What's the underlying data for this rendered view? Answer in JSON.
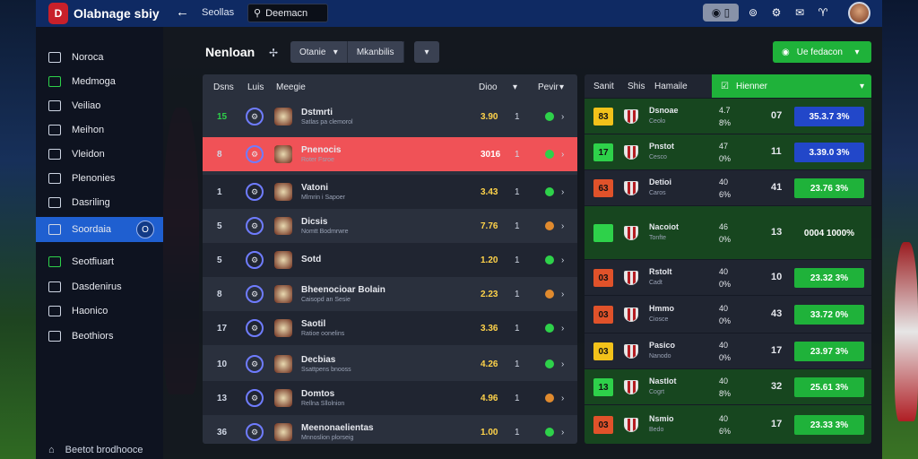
{
  "app": {
    "title": "Olabnage sbiy",
    "logo": "D"
  },
  "topbar": {
    "search_label": "Seollas",
    "search_value": "Deemacn",
    "icons": [
      "toggle-icon",
      "star-icon",
      "gear-icon",
      "bell-icon",
      "trophy-icon"
    ]
  },
  "sidebar": {
    "items": [
      {
        "label": "Noroca"
      },
      {
        "label": "Medmoga"
      },
      {
        "label": "Veiliao"
      },
      {
        "label": "Meihon"
      },
      {
        "label": "Vleidon"
      },
      {
        "label": "Plenonies"
      },
      {
        "label": "Dasriling"
      },
      {
        "label": "Soordaia",
        "badge": "O"
      },
      {
        "label": "Seotfiuart"
      },
      {
        "label": "Dasdenirus"
      },
      {
        "label": "Haonico"
      },
      {
        "label": "Beothiors"
      }
    ],
    "footer": "Beetot brodhooce"
  },
  "main": {
    "title": "Nenloan",
    "filter1": "Otanie",
    "filter2": "Mkanbilis",
    "cta": "Ue fedacon"
  },
  "left_table": {
    "headers": [
      "Dsns",
      "Luis",
      "Meegie",
      "Dioo",
      "Pevir"
    ],
    "rows": [
      {
        "num": "15",
        "name": "Dstmrti",
        "sub": "Satlas pa clemorol",
        "odds": "3.90",
        "x": "1"
      },
      {
        "num": "8",
        "name": "Pnenocis",
        "sub": "Roter Fsroe",
        "odds": "3016",
        "x": "1"
      },
      {
        "num": "1",
        "name": "Vatoni",
        "sub": "Mlmrin i Sapoer",
        "odds": "3.43",
        "x": "1"
      },
      {
        "num": "5",
        "name": "Dicsis",
        "sub": "Nomtt Bodmrwre",
        "odds": "7.76",
        "x": "1"
      },
      {
        "num": "5",
        "name": "Sotd",
        "sub": "",
        "odds": "1.20",
        "x": "1"
      },
      {
        "num": "8",
        "name": "Bheenocioar Bolain",
        "sub": "Caisopd an Sesie",
        "odds": "2.23",
        "x": "1"
      },
      {
        "num": "17",
        "name": "Saotil",
        "sub": "Ratioe oonelins",
        "odds": "3.36",
        "x": "1"
      },
      {
        "num": "10",
        "name": "Decbias",
        "sub": "Ssattpens bnooss",
        "odds": "4.26",
        "x": "1"
      },
      {
        "num": "13",
        "name": "Domtos",
        "sub": "Rellna Sllolnion",
        "odds": "4.96",
        "x": "1"
      },
      {
        "num": "36",
        "name": "Meenonaelientas",
        "sub": "Mnnoslion plorseig",
        "odds": "1.00",
        "x": "1"
      }
    ]
  },
  "right_table": {
    "headers": [
      "Sanit",
      "Shis",
      "Hamaile"
    ],
    "tab": "Hienner",
    "rows": [
      {
        "sq": "83",
        "name": "Dsnoae",
        "sub": "Ceolo",
        "a": "4.7",
        "b": "8%",
        "n": "07",
        "pct": "35.3.7  3%"
      },
      {
        "sq": "17",
        "name": "Pnstot",
        "sub": "Cesco",
        "a": "47",
        "b": "0%",
        "n": "11",
        "pct": "3.39.0  3%"
      },
      {
        "sq": "63",
        "name": "Detioi",
        "sub": "Caros",
        "a": "40",
        "b": "6%",
        "n": "41",
        "pct": "23.76  3%"
      },
      {
        "sq": "",
        "name": "Nacoiot",
        "sub": "Tonfte",
        "a": "46",
        "b": "0%",
        "n": "13",
        "pct": "0004 1000%"
      },
      {
        "sq": "03",
        "name": "Rstolt",
        "sub": "Cadt",
        "a": "40",
        "b": "0%",
        "n": "10",
        "pct": "23.32  3%"
      },
      {
        "sq": "03",
        "name": "Hmmo",
        "sub": "Ciosce",
        "a": "40",
        "b": "0%",
        "n": "43",
        "pct": "33.72  0%"
      },
      {
        "sq": "03",
        "name": "Pasico",
        "sub": "Nanodo",
        "a": "40",
        "b": "0%",
        "n": "17",
        "pct": "23.97  3%"
      },
      {
        "sq": "13",
        "name": "Nastlot",
        "sub": "Cogrt",
        "a": "40",
        "b": "8%",
        "n": "32",
        "pct": "25.61  3%"
      },
      {
        "sq": "03",
        "name": "Nsmio",
        "sub": "Bedo",
        "a": "40",
        "b": "6%",
        "n": "17",
        "pct": "23.33  3%"
      }
    ]
  },
  "colors": {
    "accent_green": "#1fb23a",
    "highlight_red": "#f05257",
    "brand_blue": "#0f2a63",
    "odds_yellow": "#ffd34a"
  }
}
